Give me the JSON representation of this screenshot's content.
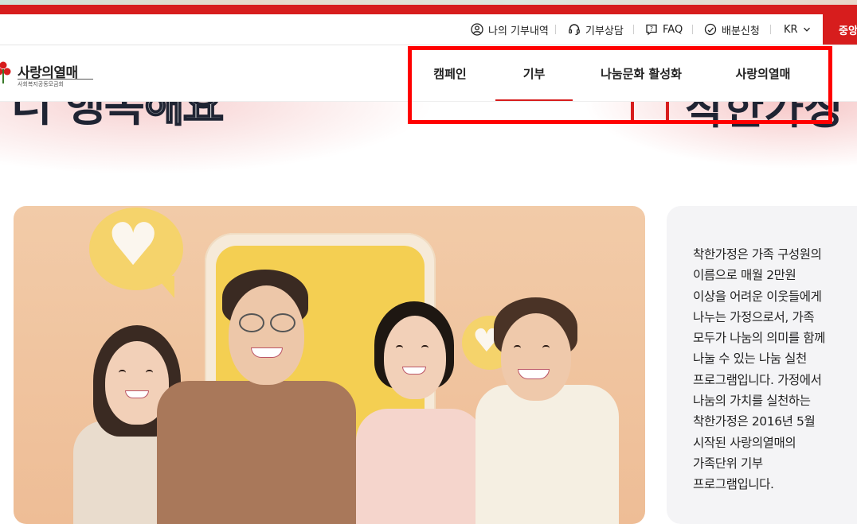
{
  "utility_bar": {
    "items": [
      {
        "label": "나의 기부내역",
        "icon": "user-circle-icon"
      },
      {
        "label": "기부상담",
        "icon": "headset-icon"
      },
      {
        "label": "FAQ",
        "icon": "faq-icon"
      },
      {
        "label": "배분신청",
        "icon": "coin-hand-icon"
      }
    ],
    "language": "KR",
    "cta_label": "중앙"
  },
  "header": {
    "logo_text": "사랑의열매",
    "logo_sub": "사회복지공동모금회",
    "nav": [
      "캠페인",
      "기부",
      "나눔문화 활성화",
      "사랑의열매"
    ],
    "active_nav_index": 1
  },
  "hero": {
    "text_solid": "너 행복",
    "text_outline": "해요",
    "right_text": "착한가정"
  },
  "info": {
    "lines": [
      "착한가정은 가족 구성원의",
      "이름으로 매월 2만원",
      "이상을 어려운 이웃들에게",
      "나누는 가정으로서, 가족",
      "모두가 나눔의 의미를 함께",
      "나눌 수 있는 나눔 실천",
      "프로그램입니다. 가정에서",
      "나눔의 가치를 실천하는",
      "착한가정은 2016년 5월",
      "시작된 사랑의열매의",
      "가족단위 기부",
      "프로그램입니다."
    ]
  },
  "colors": {
    "brand_red": "#d71d1d",
    "highlight_red": "#ff0000",
    "panel_bg": "#f4f4f6"
  }
}
